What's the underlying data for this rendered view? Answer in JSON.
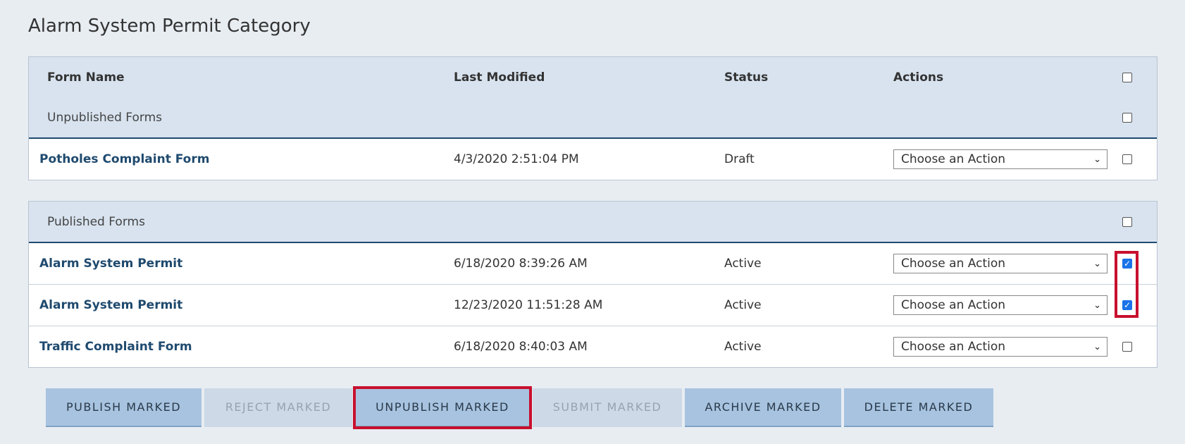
{
  "page_title": "Alarm System Permit Category",
  "columns": {
    "form_name": "Form Name",
    "last_modified": "Last Modified",
    "status": "Status",
    "actions": "Actions"
  },
  "unpublished_group": {
    "label": "Unpublished Forms",
    "rows": [
      {
        "name": "Potholes Complaint Form",
        "modified": "4/3/2020 2:51:04 PM",
        "status": "Draft",
        "action": "Choose an Action",
        "checked": false
      }
    ]
  },
  "published_group": {
    "label": "Published Forms",
    "rows": [
      {
        "name": "Alarm System Permit",
        "modified": "6/18/2020 8:39:26 AM",
        "status": "Active",
        "action": "Choose an Action",
        "checked": true
      },
      {
        "name": "Alarm System Permit",
        "modified": "12/23/2020 11:51:28 AM",
        "status": "Active",
        "action": "Choose an Action",
        "checked": true
      },
      {
        "name": "Traffic Complaint Form",
        "modified": "6/18/2020 8:40:03 AM",
        "status": "Active",
        "action": "Choose an Action",
        "checked": false
      }
    ]
  },
  "buttons": {
    "publish": "PUBLISH MARKED",
    "reject": "REJECT MARKED",
    "unpublish": "UNPUBLISH MARKED",
    "submit": "SUBMIT MARKED",
    "archive": "ARCHIVE MARKED",
    "delete": "DELETE MARKED"
  },
  "colors": {
    "header_bg": "#d8e3ef",
    "link": "#1f4a6e",
    "highlight": "#c8102e",
    "button_primary": "#a7c3e0"
  }
}
